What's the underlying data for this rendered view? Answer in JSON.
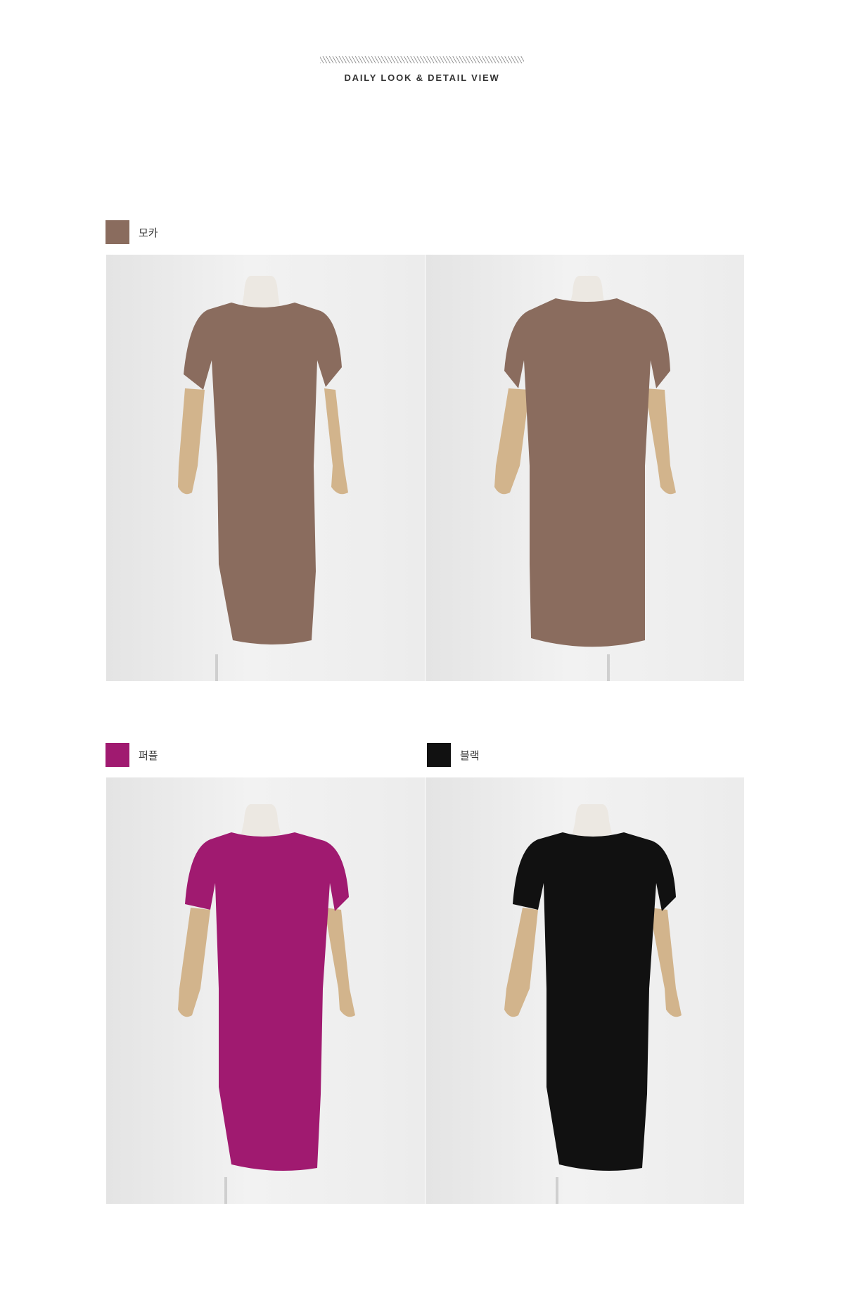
{
  "header": {
    "title": "DAILY LOOK & DETAIL VIEW"
  },
  "colors": [
    {
      "name": "모카",
      "hex": "#8a6c5e"
    },
    {
      "name": "퍼플",
      "hex": "#a01a70"
    },
    {
      "name": "블랙",
      "hex": "#111111"
    }
  ],
  "photos": [
    {
      "color": "모카",
      "view": "front"
    },
    {
      "color": "모카",
      "view": "back"
    },
    {
      "color": "퍼플",
      "view": "front"
    },
    {
      "color": "블랙",
      "view": "front"
    }
  ]
}
